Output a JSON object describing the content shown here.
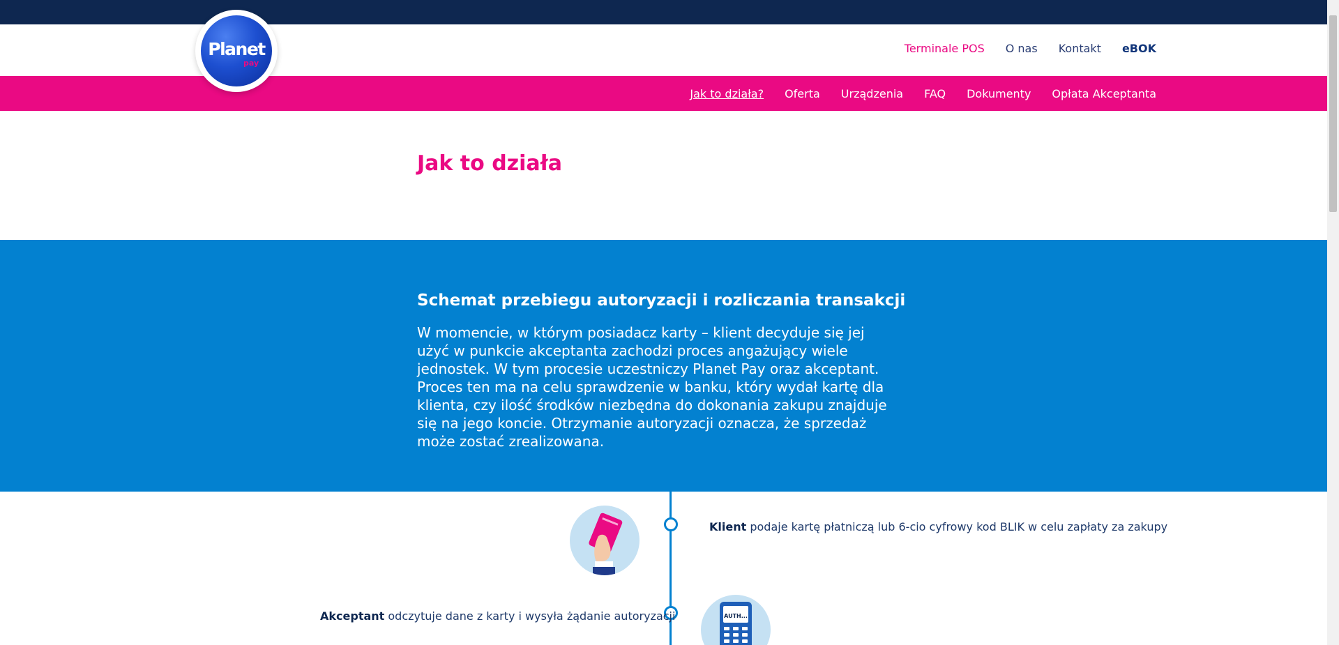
{
  "brand": {
    "name": "Planet",
    "sub": "pay"
  },
  "top_nav": [
    {
      "label": "Terminale POS"
    },
    {
      "label": "O nas"
    },
    {
      "label": "Kontakt"
    },
    {
      "label": "eBOK"
    }
  ],
  "main_nav": [
    {
      "label": "Jak to działa?"
    },
    {
      "label": "Oferta"
    },
    {
      "label": "Urządzenia"
    },
    {
      "label": "FAQ"
    },
    {
      "label": "Dokumenty"
    },
    {
      "label": "Opłata Akceptanta"
    }
  ],
  "page_title": "Jak to działa",
  "section": {
    "heading": "Schemat przebiegu autoryzacji i rozliczania transakcji",
    "body": "W momencie, w którym posiadacz karty – klient decyduje się jej użyć w punkcie akceptanta zachodzi proces angażujący wiele jednostek. W tym procesie uczestniczy Planet Pay oraz akceptant. Proces ten ma na celu sprawdzenie w banku, który wydał kartę dla klienta, czy ilość środków niezbędna do dokonania zakupu znajduje się na jego koncie. Otrzymanie autoryzacji oznacza, że sprzedaż może zostać zrealizowana."
  },
  "steps": [
    {
      "actor": "Klient",
      "text": " podaje kartę płatniczą lub 6-cio cyfrowy kod BLIK w celu zapłaty za zakupy",
      "icon": "card-hand-icon"
    },
    {
      "actor": "Akceptant",
      "text": " odczytuje dane z karty i wysyła żądanie autoryzacji",
      "icon": "pos-terminal-icon",
      "screen_text": "AUTH..."
    }
  ],
  "colors": {
    "navy": "#0e2750",
    "pink": "#ea0a83",
    "blue": "#0381d0"
  }
}
